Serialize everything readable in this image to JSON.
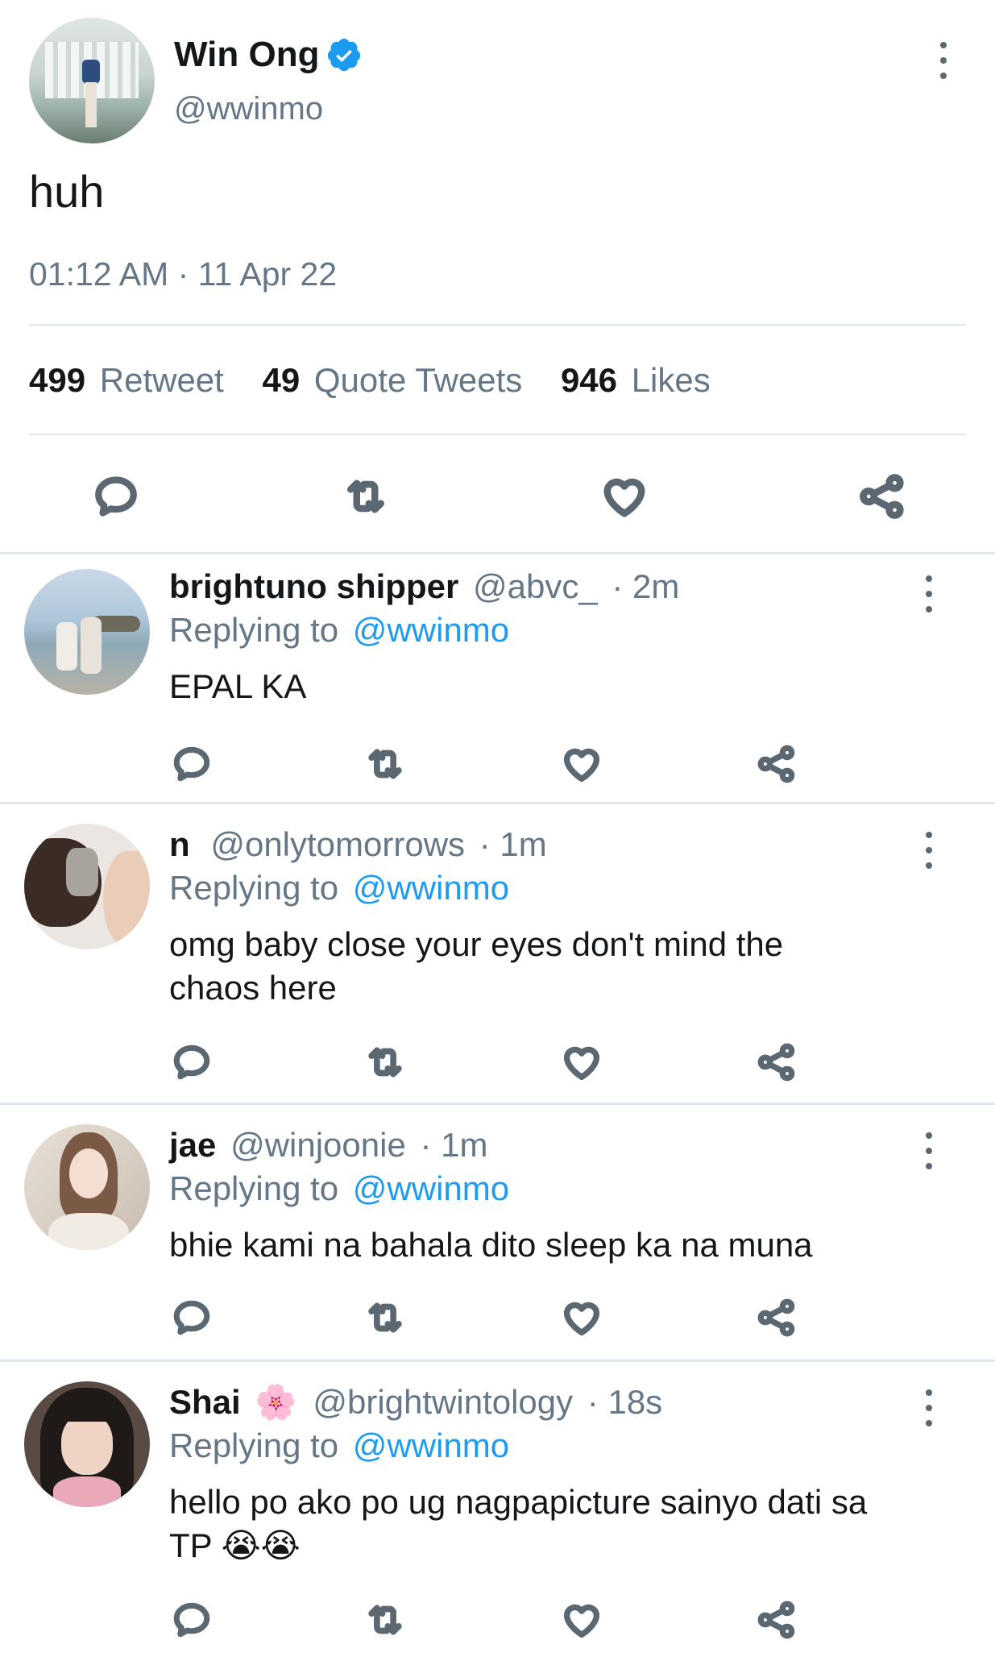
{
  "main_tweet": {
    "author_name": "Win Ong",
    "handle": "@wwinmo",
    "text": "huh",
    "timestamp": "01:12 AM · 11 Apr 22",
    "stats": {
      "retweets_count": "499",
      "retweets_label": "Retweet",
      "quotes_count": "49",
      "quotes_label": "Quote Tweets",
      "likes_count": "946",
      "likes_label": "Likes"
    }
  },
  "replies": [
    {
      "name": "brightuno shipper",
      "handle": "@abvc_",
      "time": "· 2m",
      "replying_prefix": "Replying to",
      "replying_handle": "@wwinmo",
      "text_lines": [
        "EPAL KA"
      ]
    },
    {
      "name": "n",
      "handle": "@onlytomorrows",
      "time": "· 1m",
      "replying_prefix": "Replying to",
      "replying_handle": "@wwinmo",
      "text_lines": [
        "omg baby close your eyes don't mind the",
        "chaos here"
      ]
    },
    {
      "name": "jae",
      "handle": "@winjoonie",
      "time": "· 1m",
      "replying_prefix": "Replying to",
      "replying_handle": "@wwinmo",
      "text_lines": [
        "bhie kami na bahala dito sleep ka na muna"
      ]
    },
    {
      "name": "Shai",
      "name_emoji": "🌸",
      "handle": "@brightwintology",
      "time": "· 18s",
      "replying_prefix": "Replying to",
      "replying_handle": "@wwinmo",
      "text_lines": [
        "hello po ako po ug nagpapicture sainyo dati sa",
        "TP 😭😭"
      ]
    }
  ],
  "icons": [
    "verified-badge-icon",
    "more-vert-icon",
    "reply-icon",
    "retweet-icon",
    "like-icon",
    "share-icon"
  ],
  "colors": {
    "link_blue": "#1d9bf0",
    "muted_gray": "#657786",
    "divider": "#e1e8ed",
    "verified": "#1d9bf0"
  }
}
